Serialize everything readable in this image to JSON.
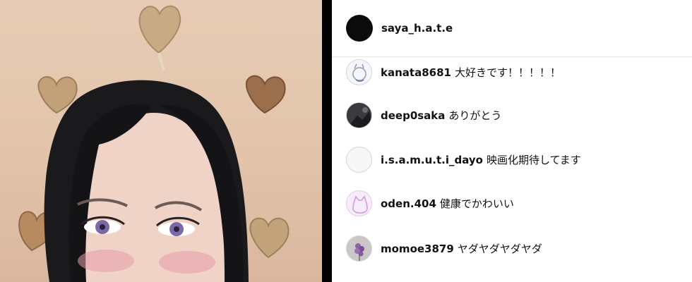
{
  "post": {
    "author": "saya_h.a.t.e"
  },
  "comments": [
    {
      "user": "kanata8681",
      "text": "大好きです！！！！！",
      "avatar_icon": "sketch-avatar-icon"
    },
    {
      "user": "deep0saka",
      "text": "ありがとう",
      "avatar_icon": "dark-photo-avatar-icon"
    },
    {
      "user": "i.s.a.m.u.t.i_dayo",
      "text": "映画化期待してます",
      "avatar_icon": "blank-avatar-icon"
    },
    {
      "user": "oden.404",
      "text": "健康でかわいい",
      "avatar_icon": "cat-outline-avatar-icon"
    },
    {
      "user": "momoe3879",
      "text": "ヤダヤダヤダヤダ",
      "avatar_icon": "purple-flower-avatar-icon"
    }
  ],
  "colors": {
    "photo_background": "#e2c4ab",
    "divider": "#000000",
    "cat_avatar_accent": "#d19be0"
  }
}
